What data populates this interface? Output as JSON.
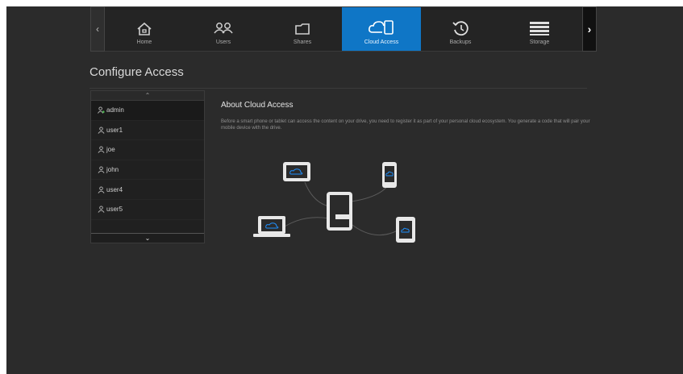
{
  "nav": {
    "items": [
      {
        "label": "Home",
        "icon": "home-icon"
      },
      {
        "label": "Users",
        "icon": "users-icon"
      },
      {
        "label": "Shares",
        "icon": "folder-icon"
      },
      {
        "label": "Cloud Access",
        "icon": "cloud-device-icon",
        "active": true
      },
      {
        "label": "Backups",
        "icon": "backup-icon"
      },
      {
        "label": "Storage",
        "icon": "storage-icon"
      }
    ]
  },
  "page": {
    "title": "Configure Access"
  },
  "users": {
    "items": [
      {
        "name": "admin"
      },
      {
        "name": "user1"
      },
      {
        "name": "joe"
      },
      {
        "name": "john"
      },
      {
        "name": "user4"
      },
      {
        "name": "user5"
      }
    ],
    "selected_index": 0
  },
  "about": {
    "title": "About Cloud Access",
    "text": "Before a smart phone or tablet can access the content on your drive, you need to register it as part of your personal cloud ecosystem. You generate a code that will pair your mobile device with the drive."
  },
  "colors": {
    "accent": "#0f76c6",
    "background": "#2b2b2b",
    "admin_icon": "#4caf50"
  }
}
